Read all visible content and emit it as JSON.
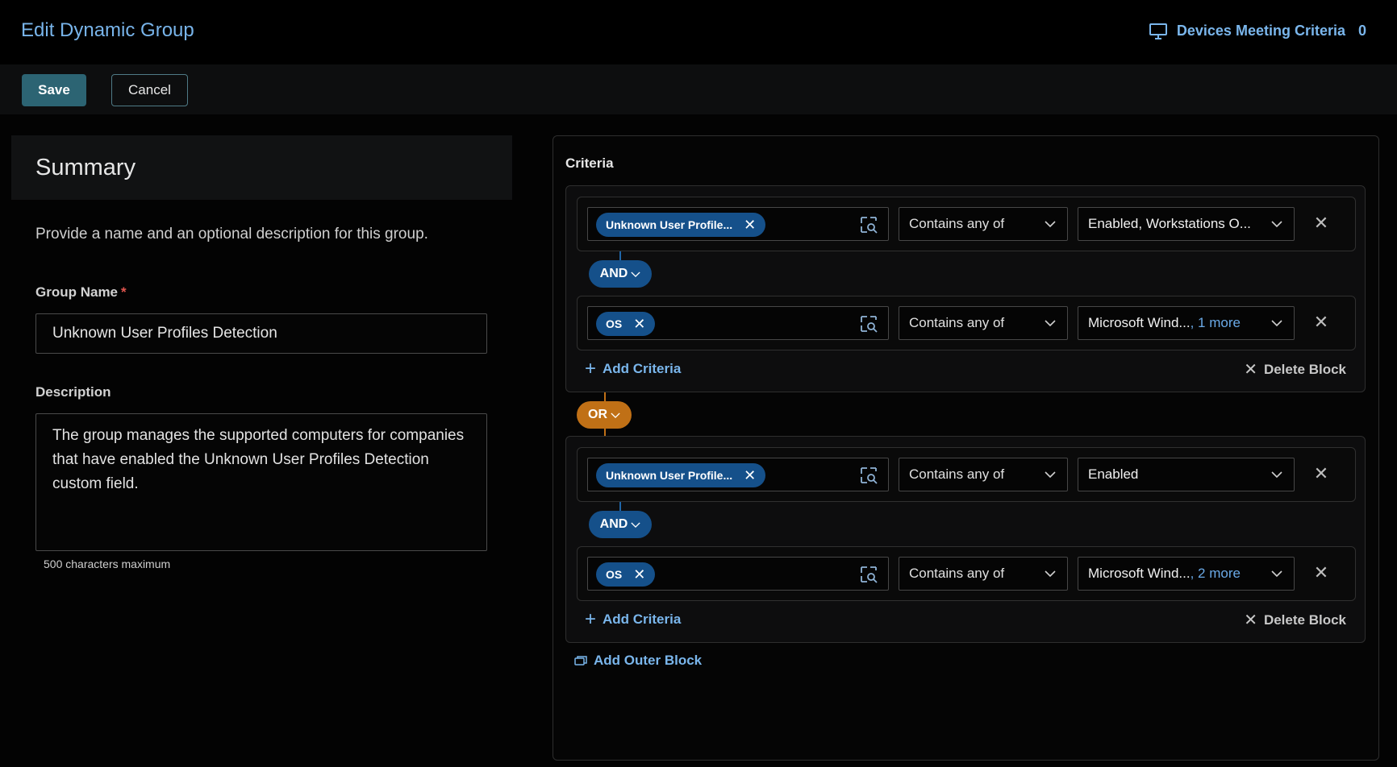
{
  "header": {
    "title": "Edit Dynamic Group",
    "devices_label": "Devices Meeting Criteria",
    "devices_count": "0",
    "devices_icon": "monitor-icon"
  },
  "toolbar": {
    "save_label": "Save",
    "cancel_label": "Cancel"
  },
  "summary": {
    "title": "Summary",
    "description": "Provide a name and an optional description for this group.",
    "group_name_label": "Group Name",
    "required_mark": "*",
    "group_name_value": "Unknown User Profiles Detection",
    "description_label": "Description",
    "description_value": "The group manages the supported computers for companies that have enabled the Unknown User Profiles Detection custom field.",
    "hint": "500 characters maximum"
  },
  "criteria": {
    "title": "Criteria",
    "add_criteria_label": "Add Criteria",
    "delete_block_label": "Delete Block",
    "add_outer_block_label": "Add Outer Block",
    "or_label": "OR",
    "and_label": "AND",
    "blocks": [
      {
        "rows": [
          {
            "field": "Unknown User Profile...",
            "operator": "Contains any of",
            "value": "Enabled, Workstations O...",
            "more": ""
          },
          {
            "field": "OS",
            "operator": "Contains any of",
            "value": "Microsoft Wind...",
            "more": ", 1 more"
          }
        ]
      },
      {
        "rows": [
          {
            "field": "Unknown User Profile...",
            "operator": "Contains any of",
            "value": "Enabled",
            "more": ""
          },
          {
            "field": "OS",
            "operator": "Contains any of",
            "value": "Microsoft Wind...",
            "more": ", 2 more"
          }
        ]
      }
    ]
  },
  "colors": {
    "accent_blue": "#7ab6ec",
    "chip_blue": "#15508a",
    "or_orange": "#c07016",
    "save_teal": "#2c6473"
  }
}
